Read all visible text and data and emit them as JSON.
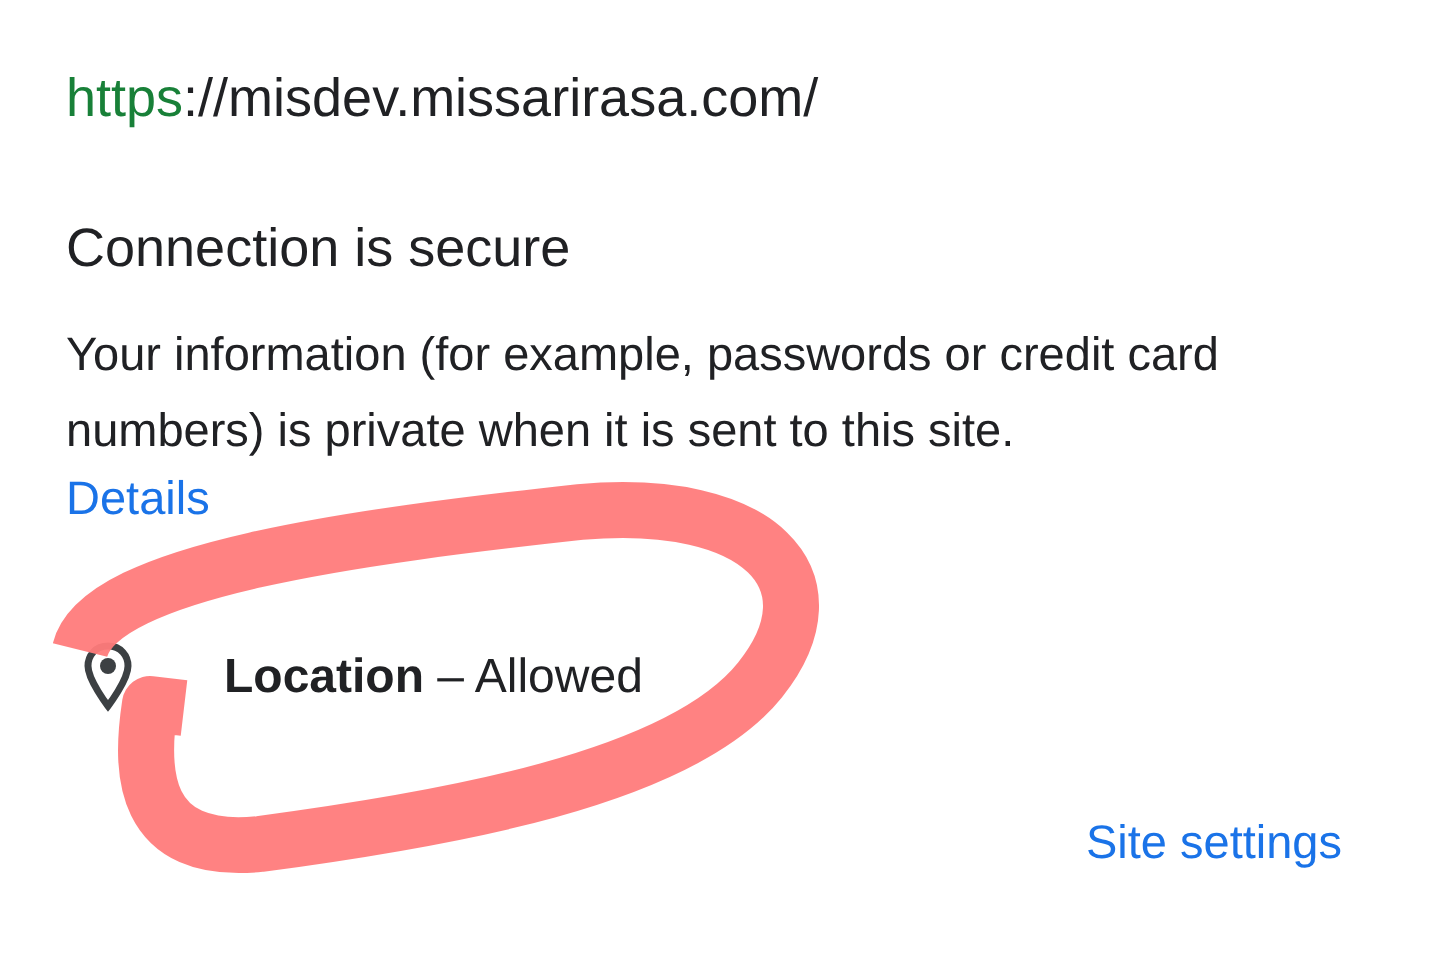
{
  "url": {
    "scheme": "https",
    "rest": "://misdev.missarirasa.com/"
  },
  "connection": {
    "title": "Connection is secure",
    "description": "Your information (for example, passwords or credit card numbers) is private when it is sent to this site.",
    "details_link": "Details"
  },
  "permissions": [
    {
      "name": "Location",
      "separator": "–",
      "status": "Allowed"
    }
  ],
  "site_settings_link": "Site settings"
}
